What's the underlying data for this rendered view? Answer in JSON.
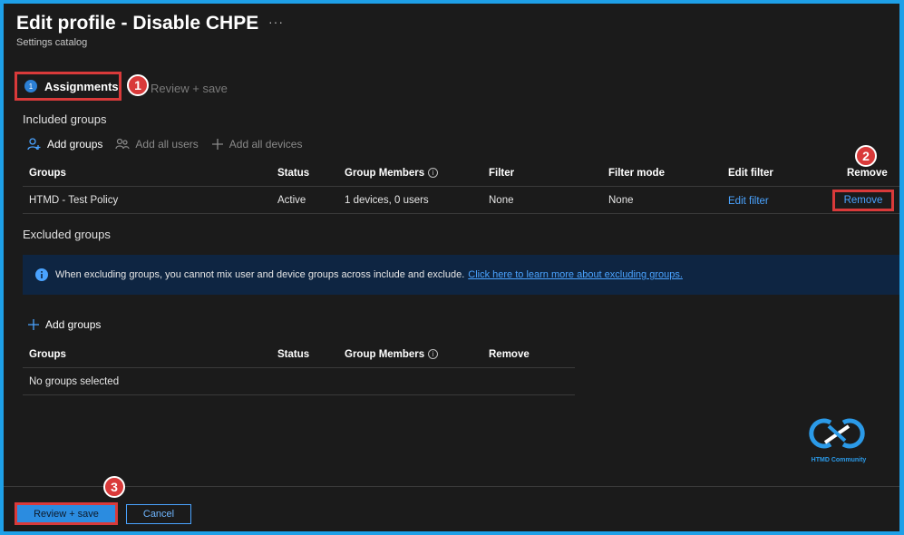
{
  "header": {
    "title": "Edit profile - Disable CHPE",
    "subtitle": "Settings catalog",
    "more_label": "···"
  },
  "wizard": {
    "steps": [
      {
        "number": "1",
        "label": "Assignments",
        "active": true
      },
      {
        "label": "Review + save",
        "active": false
      }
    ]
  },
  "annotations": [
    "1",
    "2",
    "3"
  ],
  "included": {
    "heading": "Included groups",
    "toolbar": {
      "add_groups": "Add groups",
      "add_all_users": "Add all users",
      "add_all_devices": "Add all devices"
    },
    "columns": [
      "Groups",
      "Status",
      "Group Members",
      "Filter",
      "Filter mode",
      "Edit filter",
      "Remove"
    ],
    "rows": [
      {
        "group": "HTMD - Test Policy",
        "status": "Active",
        "members": "1 devices, 0 users",
        "filter": "None",
        "filter_mode": "None",
        "edit_filter": "Edit filter",
        "remove": "Remove"
      }
    ]
  },
  "excluded": {
    "heading": "Excluded groups",
    "info_text": "When excluding groups, you cannot mix user and device groups across include and exclude.",
    "info_link": "Click here to learn more about excluding groups.",
    "add_groups": "Add groups",
    "columns": [
      "Groups",
      "Status",
      "Group Members",
      "Remove"
    ],
    "empty_text": "No groups selected"
  },
  "logo": {
    "text": "HTMD Community"
  },
  "footer": {
    "review_save": "Review + save",
    "cancel": "Cancel"
  },
  "colors": {
    "accent": "#2b8ce0",
    "annotation": "#d93a3a",
    "link": "#4aa3ff",
    "background": "#1b1b1b",
    "frame": "#1ea0e8"
  }
}
